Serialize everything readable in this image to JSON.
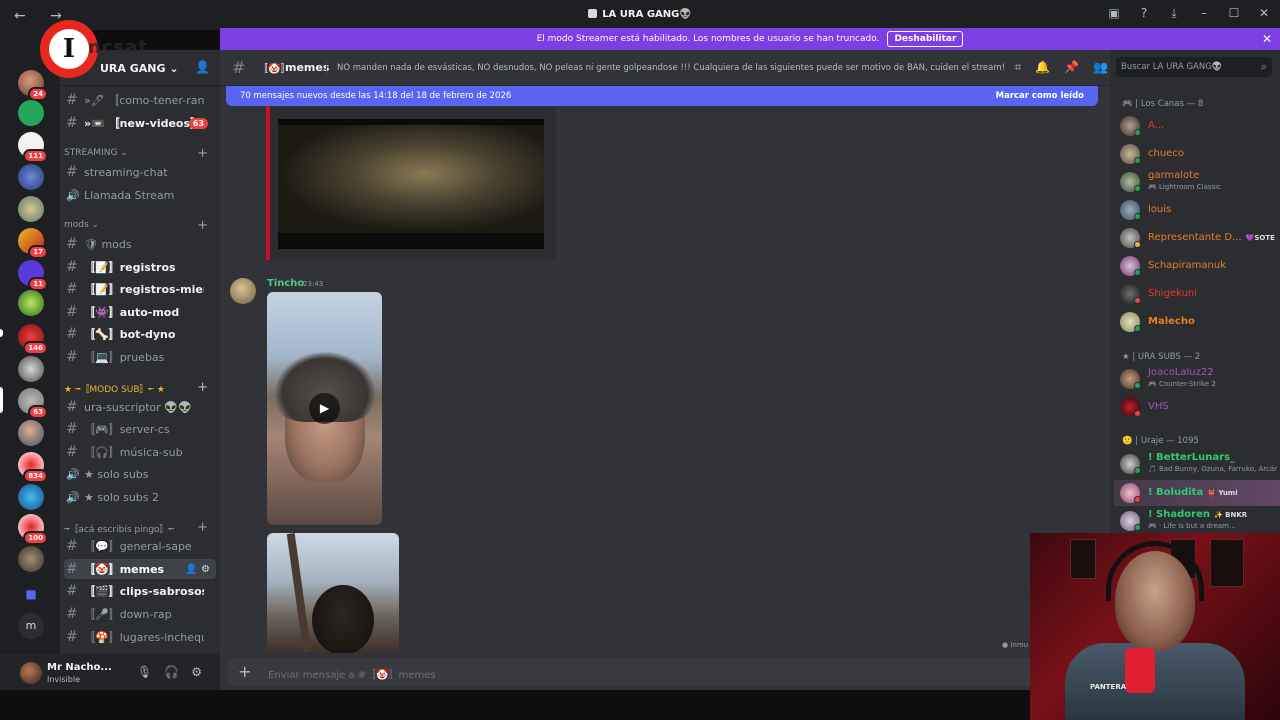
{
  "window": {
    "title": "LA URA GANG👽",
    "nav_icons": "← →"
  },
  "streamer_banner": {
    "text": "El modo Streamer está habilitado. Los nombres de usuario se han truncado.",
    "button": "Deshabilitar",
    "close": "✕"
  },
  "watermark": {
    "letter": "I",
    "text": "ncsat"
  },
  "rail_badges": [
    "24",
    "111",
    "17",
    "11",
    "146",
    "63",
    "834",
    "100"
  ],
  "rail_letter": "m",
  "server": {
    "name": "URA GANG",
    "chevron": "⌄"
  },
  "channels": {
    "top1": "»🖊 〚como-tener-rang...",
    "new_videos": "»📼 〚new-videos〛",
    "new_videos_count": "63",
    "streaming_cat": "STREAMING",
    "streaming_chat": "streaming-chat",
    "llamada_stream": "Llamada Stream",
    "mods_cat": "mods",
    "mods": "🛡 mods",
    "registros": "〚📝〛registros",
    "registros_miem": "〚📝〛registros-miem...",
    "auto_mod": "〚👾〛auto-mod",
    "bot_dyno": "〚🦴〛bot-dyno",
    "pruebas": "〚💻〛pruebas",
    "modo_sub_cat": "★ ╼〚MODO SUB〛╾ ★",
    "ura_suscriptor": "ura-suscriptor 👽👽",
    "server_cs": "〚🎮〛server-cs",
    "musica_sub": "〚🎧〛música-sub",
    "solo_subs": "★ solo subs",
    "solo_subs2": "★ solo subs 2",
    "aca_cat": "╼〚acá escribís pingo〛╾",
    "general_sape": "〚💬〛general-sape",
    "memes": "〚🤡〛memes",
    "clips": "〚🎬〛clips-sabrosos",
    "down_rap": "〚🎤〛down-rap",
    "lugares": "〚🍄〛lugares-inchequ..."
  },
  "user": {
    "name": "Mr Nacho...",
    "status": "Invisible"
  },
  "channel_header": {
    "emoji": "〚🤡〛",
    "name": "memes",
    "topic": "NO manden nada de esvásticas, NO desnudos, NO peleas ni gente golpeandose !!! Cualquiera de las siguientes puede ser motivo de BAN, cuiden el stream!"
  },
  "new_messages_bar": {
    "text": "70 mensajes nuevos desde las 14:18 del 18 de febrero de 2026",
    "action": "Marcar como leído"
  },
  "message": {
    "author": "Tincho",
    "time": "23:43"
  },
  "composer": {
    "placeholder": "Enviar mensaje a #〚🤡〛memes",
    "plus": "+"
  },
  "hint": "● Inmu",
  "members": {
    "search": "Buscar LA URA GANG👽",
    "groups": [
      {
        "title": "🎮 | Los Canas — 8"
      },
      {
        "title": "★ | URA SUBS — 2"
      },
      {
        "title": "🙂 | Uraje — 1095"
      }
    ],
    "list": [
      {
        "name": "A...",
        "color": "#e8382d"
      },
      {
        "name": "chueco",
        "color": "#e67e22"
      },
      {
        "name": "garmalote",
        "color": "#e67e22",
        "activity": "🎮 Lightroom Classic"
      },
      {
        "name": "louis",
        "color": "#e67e22"
      },
      {
        "name": "Representante D...",
        "color": "#e67e22",
        "tag": "💜SOTE"
      },
      {
        "name": "Schapiramanuk",
        "color": "#e67e22"
      },
      {
        "name": "Shigekuni",
        "color": "#e8382d"
      },
      {
        "name": "Malecho",
        "color": "#e67e22"
      },
      {
        "name": "JoacoLaluz22",
        "color": "#9b59b6",
        "activity": "🎮 Counter-Strike 2"
      },
      {
        "name": "VHS",
        "color": "#9b59b6"
      },
      {
        "name": "! BetterLunars_",
        "color": "#2ecc71",
        "activity": "🎵 Bad Bunny, Ozuna, Farruko, Arcár"
      },
      {
        "name": "! Boludita",
        "color": "#2ecc71",
        "tag": "👹 Yumi"
      },
      {
        "name": "! Shadoren",
        "color": "#2ecc71",
        "tag": "✨ BNKR",
        "activity": "🎮 · Life is but a dream..."
      }
    ]
  },
  "webcam": {
    "vest_label": "PANTERA"
  }
}
